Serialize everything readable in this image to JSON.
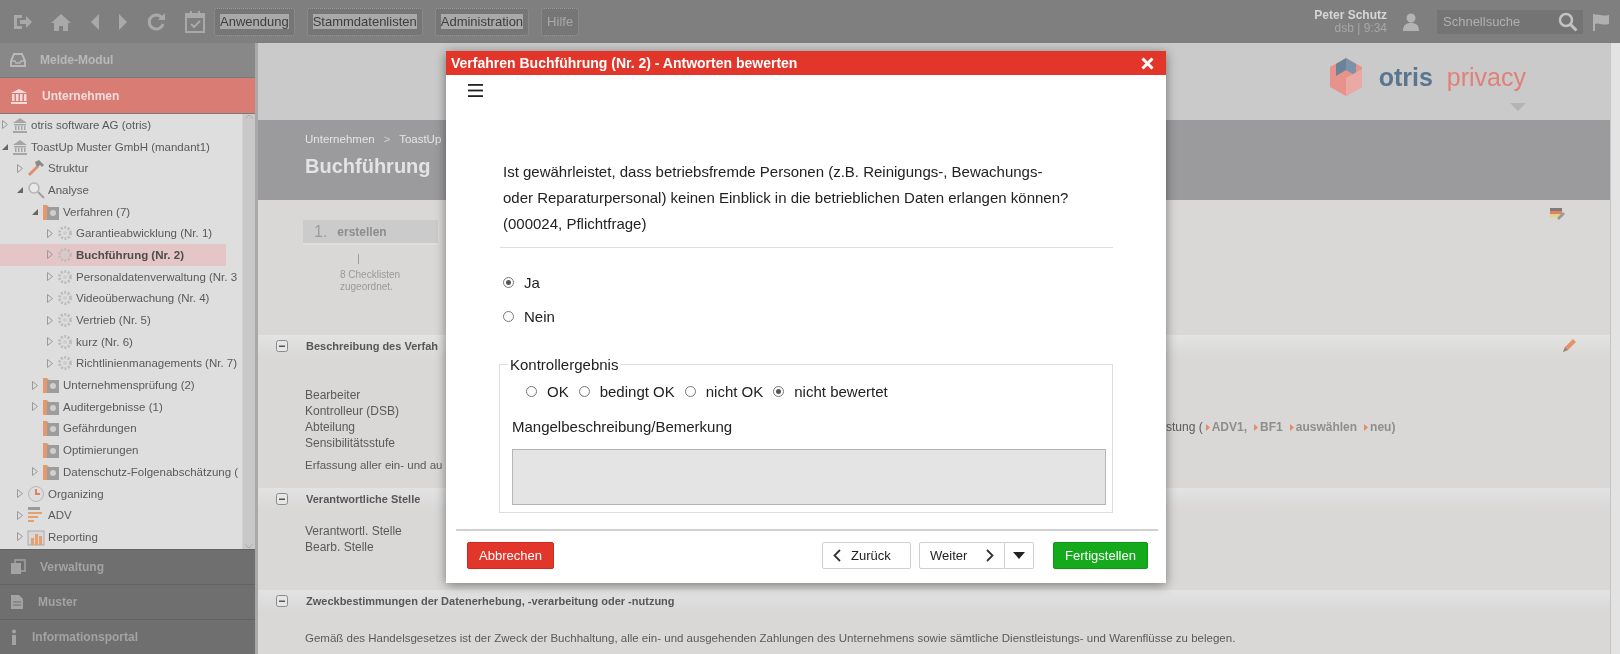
{
  "topbar": {
    "menus": [
      "Anwendung",
      "Stammdatenlisten",
      "Administration",
      "Hilfe"
    ],
    "user": {
      "name": "Peter Schutz",
      "info": "dsb | 9:34"
    },
    "search": {
      "placeholder": "Schnellsuche"
    }
  },
  "sidebar": {
    "modules": [
      {
        "label": "Melde-Modul",
        "selected": false,
        "kind": "inbox"
      },
      {
        "label": "Unternehmen",
        "selected": true,
        "kind": "bank"
      }
    ],
    "tree": [
      {
        "label": "otris software AG (otris)",
        "kind": "company",
        "expanded": false,
        "selected": false
      },
      {
        "label": "ToastUp Muster GmbH (mandant1)",
        "kind": "company",
        "expanded": true,
        "selected": false,
        "children": [
          {
            "label": "Struktur",
            "kind": "tool",
            "expanded": false,
            "selected": false
          },
          {
            "label": "Analyse",
            "kind": "search",
            "expanded": true,
            "selected": false,
            "children": [
              {
                "label": "Verfahren (7)",
                "kind": "folder",
                "expanded": true,
                "selected": false,
                "children": [
                  {
                    "label": "Garantieabwicklung (Nr. 1)",
                    "kind": "gear",
                    "expanded": false,
                    "selected": false
                  },
                  {
                    "label": "Buchführung (Nr. 2)",
                    "kind": "gear",
                    "expanded": false,
                    "selected": true
                  },
                  {
                    "label": "Personaldatenverwaltung (Nr. 3",
                    "kind": "gear",
                    "expanded": false,
                    "selected": false
                  },
                  {
                    "label": "Videoüberwachung (Nr. 4)",
                    "kind": "gear",
                    "expanded": false,
                    "selected": false
                  },
                  {
                    "label": "Vertrieb (Nr. 5)",
                    "kind": "gear",
                    "expanded": false,
                    "selected": false
                  },
                  {
                    "label": "kurz (Nr. 6)",
                    "kind": "gear",
                    "expanded": false,
                    "selected": false
                  },
                  {
                    "label": "Richtlinienmanagements (Nr. 7)",
                    "kind": "gear",
                    "expanded": false,
                    "selected": false
                  }
                ]
              },
              {
                "label": "Unternehmensprüfung (2)",
                "kind": "folder",
                "expanded": false,
                "selected": false
              },
              {
                "label": "Auditergebnisse (1)",
                "kind": "folder",
                "expanded": false,
                "selected": false
              },
              {
                "label": "Gefährdungen",
                "kind": "folder",
                "selected": false
              },
              {
                "label": "Optimierungen",
                "kind": "folder",
                "selected": false
              },
              {
                "label": "Datenschutz-Folgenabschätzung (",
                "kind": "folder",
                "expanded": false,
                "selected": false
              }
            ]
          },
          {
            "label": "Organizing",
            "kind": "clock",
            "expanded": false,
            "selected": false
          },
          {
            "label": "ADV",
            "kind": "bars",
            "expanded": false,
            "selected": false
          },
          {
            "label": "Reporting",
            "kind": "chart",
            "expanded": false,
            "selected": false
          }
        ]
      }
    ],
    "bottom_modules": [
      {
        "label": "Verwaltung",
        "kind": "copy"
      },
      {
        "label": "Muster",
        "kind": "doc"
      },
      {
        "label": "Informationsportal",
        "kind": "info"
      }
    ]
  },
  "page": {
    "logo": {
      "brand": "otris",
      "product": "privacy"
    },
    "breadcrumb": [
      {
        "kind": "link",
        "text": "Unternehmen"
      },
      {
        "kind": "separator",
        "text": ">"
      },
      {
        "kind": "link",
        "text": "ToastUp"
      }
    ],
    "title": "Buchführung",
    "workflow": {
      "number": "1.",
      "label": "erstellen",
      "note": "8 Checklisten zugeordnet."
    },
    "sections": [
      {
        "title": "Beschreibung des Verfah",
        "editable": true,
        "fields": [
          {
            "label": "Bearbeiter"
          },
          {
            "label": "Kontrolleur (DSB)"
          },
          {
            "label": "Abteilung",
            "value_prefix": "stung (",
            "links": [
              "ADV1,",
              "BF1",
              "auswählen",
              "neu)"
            ]
          },
          {
            "label": "Sensibilitätsstufe"
          }
        ],
        "text": "Erfassung aller ein- und au"
      },
      {
        "title": "Verantwortliche Stelle",
        "editable": false,
        "fields": [
          {
            "label": "Verantwortl. Stelle"
          },
          {
            "label": "Bearb. Stelle"
          }
        ]
      },
      {
        "title": "Zweckbestimmungen der Datenerhebung, -verarbeitung oder -nutzung",
        "editable": false,
        "text": "Gemäß des Handelsgesetzes ist der Zweck der Buchhaltung, alle ein- und ausgehenden Zahlungen des Unternehmens sowie sämtliche Dienstleistungs- und Warenflüsse zu belegen."
      }
    ]
  },
  "dialog": {
    "title": "Verfahren Buchführung (Nr. 2) - Antworten bewerten",
    "question": "Ist gewährleistet, dass betriebsfremde Personen (z.B. Reinigungs-, Bewachungs- oder Reparaturpersonal) keinen Einblick in die betrieblichen Daten erlangen können? (000024, Pflichtfrage)",
    "answers": [
      {
        "label": "Ja",
        "selected": true
      },
      {
        "label": "Nein",
        "selected": false
      }
    ],
    "result": {
      "legend": "Kontrollergebnis",
      "options": [
        {
          "label": "OK",
          "selected": false
        },
        {
          "label": "bedingt OK",
          "selected": false
        },
        {
          "label": "nicht OK",
          "selected": false
        },
        {
          "label": "nicht bewertet",
          "selected": true
        }
      ],
      "remark_label": "Mangelbeschreibung/Bemerkung"
    },
    "buttons": [
      {
        "label": "Abbrechen",
        "kind": "cancel"
      },
      {
        "label": "Zurück",
        "kind": "back"
      },
      {
        "label": "Weiter",
        "kind": "next"
      },
      {
        "label": "Fertigstellen",
        "kind": "finish"
      }
    ]
  }
}
